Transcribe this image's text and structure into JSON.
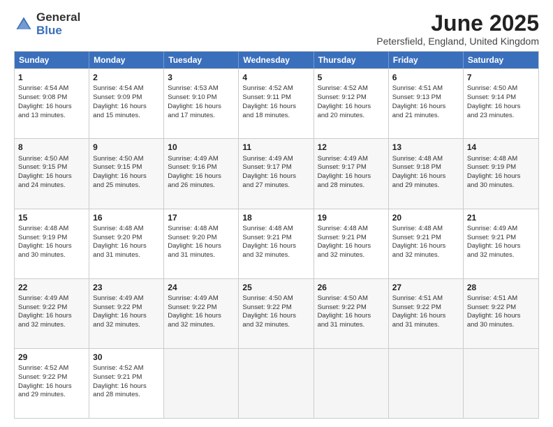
{
  "logo": {
    "general": "General",
    "blue": "Blue"
  },
  "title": "June 2025",
  "subtitle": "Petersfield, England, United Kingdom",
  "headers": [
    "Sunday",
    "Monday",
    "Tuesday",
    "Wednesday",
    "Thursday",
    "Friday",
    "Saturday"
  ],
  "rows": [
    [
      {
        "day": "1",
        "sunrise": "4:54 AM",
        "sunset": "9:08 PM",
        "daylight": "16 hours and 13 minutes."
      },
      {
        "day": "2",
        "sunrise": "4:54 AM",
        "sunset": "9:09 PM",
        "daylight": "16 hours and 15 minutes."
      },
      {
        "day": "3",
        "sunrise": "4:53 AM",
        "sunset": "9:10 PM",
        "daylight": "16 hours and 17 minutes."
      },
      {
        "day": "4",
        "sunrise": "4:52 AM",
        "sunset": "9:11 PM",
        "daylight": "16 hours and 18 minutes."
      },
      {
        "day": "5",
        "sunrise": "4:52 AM",
        "sunset": "9:12 PM",
        "daylight": "16 hours and 20 minutes."
      },
      {
        "day": "6",
        "sunrise": "4:51 AM",
        "sunset": "9:13 PM",
        "daylight": "16 hours and 21 minutes."
      },
      {
        "day": "7",
        "sunrise": "4:50 AM",
        "sunset": "9:14 PM",
        "daylight": "16 hours and 23 minutes."
      }
    ],
    [
      {
        "day": "8",
        "sunrise": "4:50 AM",
        "sunset": "9:15 PM",
        "daylight": "16 hours and 24 minutes."
      },
      {
        "day": "9",
        "sunrise": "4:50 AM",
        "sunset": "9:15 PM",
        "daylight": "16 hours and 25 minutes."
      },
      {
        "day": "10",
        "sunrise": "4:49 AM",
        "sunset": "9:16 PM",
        "daylight": "16 hours and 26 minutes."
      },
      {
        "day": "11",
        "sunrise": "4:49 AM",
        "sunset": "9:17 PM",
        "daylight": "16 hours and 27 minutes."
      },
      {
        "day": "12",
        "sunrise": "4:49 AM",
        "sunset": "9:17 PM",
        "daylight": "16 hours and 28 minutes."
      },
      {
        "day": "13",
        "sunrise": "4:48 AM",
        "sunset": "9:18 PM",
        "daylight": "16 hours and 29 minutes."
      },
      {
        "day": "14",
        "sunrise": "4:48 AM",
        "sunset": "9:19 PM",
        "daylight": "16 hours and 30 minutes."
      }
    ],
    [
      {
        "day": "15",
        "sunrise": "4:48 AM",
        "sunset": "9:19 PM",
        "daylight": "16 hours and 30 minutes."
      },
      {
        "day": "16",
        "sunrise": "4:48 AM",
        "sunset": "9:20 PM",
        "daylight": "16 hours and 31 minutes."
      },
      {
        "day": "17",
        "sunrise": "4:48 AM",
        "sunset": "9:20 PM",
        "daylight": "16 hours and 31 minutes."
      },
      {
        "day": "18",
        "sunrise": "4:48 AM",
        "sunset": "9:21 PM",
        "daylight": "16 hours and 32 minutes."
      },
      {
        "day": "19",
        "sunrise": "4:48 AM",
        "sunset": "9:21 PM",
        "daylight": "16 hours and 32 minutes."
      },
      {
        "day": "20",
        "sunrise": "4:48 AM",
        "sunset": "9:21 PM",
        "daylight": "16 hours and 32 minutes."
      },
      {
        "day": "21",
        "sunrise": "4:49 AM",
        "sunset": "9:21 PM",
        "daylight": "16 hours and 32 minutes."
      }
    ],
    [
      {
        "day": "22",
        "sunrise": "4:49 AM",
        "sunset": "9:22 PM",
        "daylight": "16 hours and 32 minutes."
      },
      {
        "day": "23",
        "sunrise": "4:49 AM",
        "sunset": "9:22 PM",
        "daylight": "16 hours and 32 minutes."
      },
      {
        "day": "24",
        "sunrise": "4:49 AM",
        "sunset": "9:22 PM",
        "daylight": "16 hours and 32 minutes."
      },
      {
        "day": "25",
        "sunrise": "4:50 AM",
        "sunset": "9:22 PM",
        "daylight": "16 hours and 32 minutes."
      },
      {
        "day": "26",
        "sunrise": "4:50 AM",
        "sunset": "9:22 PM",
        "daylight": "16 hours and 31 minutes."
      },
      {
        "day": "27",
        "sunrise": "4:51 AM",
        "sunset": "9:22 PM",
        "daylight": "16 hours and 31 minutes."
      },
      {
        "day": "28",
        "sunrise": "4:51 AM",
        "sunset": "9:22 PM",
        "daylight": "16 hours and 30 minutes."
      }
    ],
    [
      {
        "day": "29",
        "sunrise": "4:52 AM",
        "sunset": "9:22 PM",
        "daylight": "16 hours and 29 minutes."
      },
      {
        "day": "30",
        "sunrise": "4:52 AM",
        "sunset": "9:21 PM",
        "daylight": "16 hours and 28 minutes."
      },
      null,
      null,
      null,
      null,
      null
    ]
  ]
}
